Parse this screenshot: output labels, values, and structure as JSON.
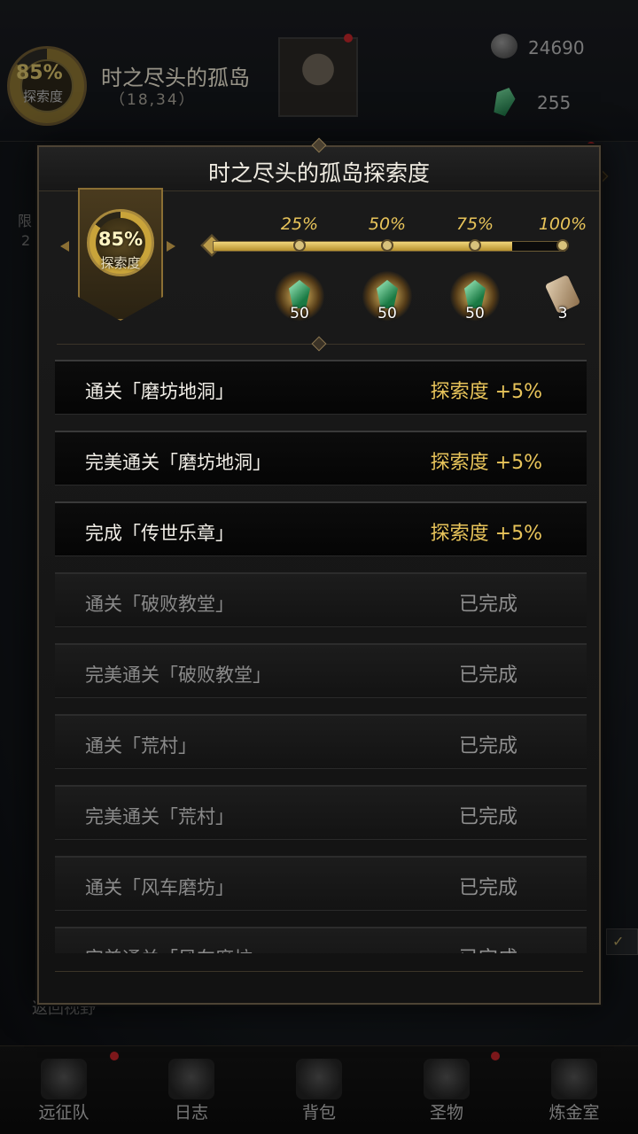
{
  "background": {
    "region_pct": "85%",
    "region_label": "探索度",
    "region_title": "时之尽头的孤岛",
    "region_coords": "（18,34）",
    "stones": "24690",
    "gems": "255",
    "side_left_text_1": "限",
    "side_left_text_2": "2",
    "check_label": "✓",
    "bottom_text": "返回视野"
  },
  "panel": {
    "title": "时之尽头的孤岛探索度",
    "progress": {
      "current_pct": "85%",
      "current_label": "探索度",
      "fill_fraction": 0.85,
      "milestones": [
        {
          "pct": "25%",
          "reward_icon": "emerald-gem-icon",
          "count": "50"
        },
        {
          "pct": "50%",
          "reward_icon": "emerald-gem-icon",
          "count": "50"
        },
        {
          "pct": "75%",
          "reward_icon": "emerald-gem-icon",
          "count": "50"
        },
        {
          "pct": "100%",
          "reward_icon": "scroll-icon",
          "count": "3"
        }
      ]
    },
    "tasks": [
      {
        "name": "通关「磨坊地洞」",
        "status": "探索度 +5%",
        "done": false
      },
      {
        "name": "完美通关「磨坊地洞」",
        "status": "探索度 +5%",
        "done": false
      },
      {
        "name": "完成「传世乐章」",
        "status": "探索度 +5%",
        "done": false
      },
      {
        "name": "通关「破败教堂」",
        "status": "已完成",
        "done": true
      },
      {
        "name": "完美通关「破败教堂」",
        "status": "已完成",
        "done": true
      },
      {
        "name": "通关「荒村」",
        "status": "已完成",
        "done": true
      },
      {
        "name": "完美通关「荒村」",
        "status": "已完成",
        "done": true
      },
      {
        "name": "通关「风车磨坊」",
        "status": "已完成",
        "done": true
      },
      {
        "name": "完美通关「风车磨坊」",
        "status": "已完成",
        "done": true
      }
    ]
  },
  "bottom_nav": [
    {
      "label": "远征队",
      "icon": "helmet-icon",
      "dot": true
    },
    {
      "label": "日志",
      "icon": "journal-icon",
      "dot": false
    },
    {
      "label": "背包",
      "icon": "backpack-icon",
      "dot": false
    },
    {
      "label": "圣物",
      "icon": "relic-icon",
      "dot": true
    },
    {
      "label": "炼金室",
      "icon": "alchemy-icon",
      "dot": false
    }
  ],
  "colors": {
    "gold": "#e8c45a",
    "text_active": "#f2efe8",
    "text_done": "#8a8a8a",
    "notify_red": "#c0262a"
  }
}
